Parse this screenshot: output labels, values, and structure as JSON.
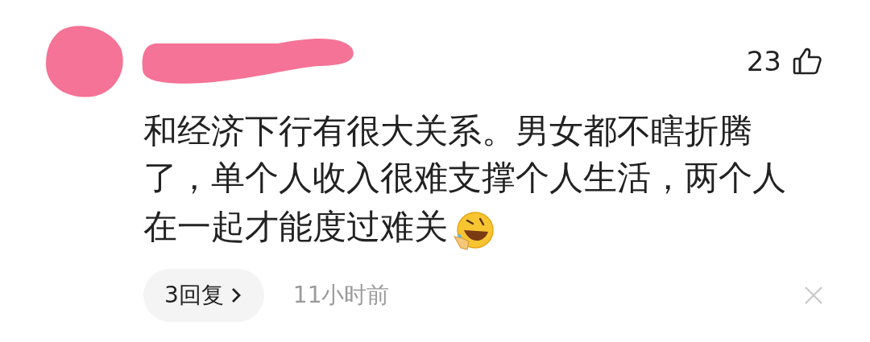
{
  "comment": {
    "likes": "23",
    "text_lines": [
      "和经济下行有很大关系。男女都不瞎折腾",
      "了，单个人收入很难支撑个人生活，两个人",
      "在一起才能度过难关"
    ],
    "replies_button": "3回复",
    "time": "11小时前"
  }
}
